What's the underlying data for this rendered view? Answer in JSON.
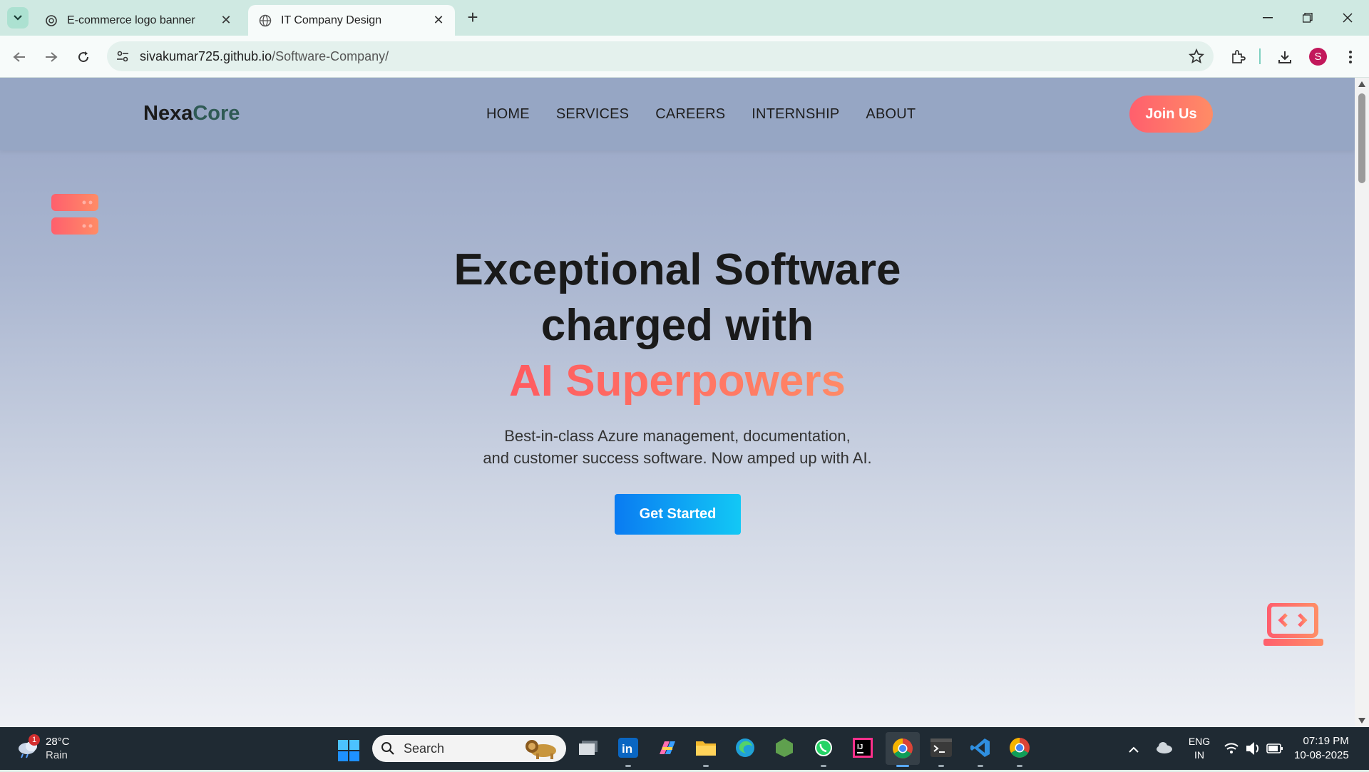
{
  "browser": {
    "tabs": [
      {
        "title": "E-commerce logo banner",
        "active": false
      },
      {
        "title": "IT Company Design",
        "active": true
      }
    ],
    "address": {
      "host": "sivakumar725.github.io",
      "path": "/Software-Company/"
    },
    "profile_initial": "S"
  },
  "site": {
    "logo_part1": "Nexa",
    "logo_part2": "Core",
    "nav": [
      "HOME",
      "SERVICES",
      "CAREERS",
      "INTERNSHIP",
      "ABOUT"
    ],
    "join_label": "Join Us",
    "hero": {
      "line1": "Exceptional Software",
      "line2": "charged with",
      "accent": "AI Superpowers",
      "sub1": "Best-in-class Azure management, documentation,",
      "sub2": "and customer success software. Now amped up with AI.",
      "cta": "Get Started"
    },
    "colors": {
      "accent_gradient_start": "#ff5f6d",
      "accent_gradient_end": "#ff8c66",
      "cta_start": "#0a7bf2",
      "cta_end": "#12c8f5"
    }
  },
  "taskbar": {
    "weather": {
      "temp": "28°C",
      "condition": "Rain",
      "badge": "1"
    },
    "search_placeholder": "Search",
    "lang1": "ENG",
    "lang2": "IN",
    "time": "07:19 PM",
    "date": "10-08-2025",
    "apps": [
      "task-view",
      "linkedin",
      "copilot",
      "file-explorer",
      "edge",
      "node",
      "whatsapp",
      "intellij",
      "chrome",
      "terminal",
      "vscode",
      "chrome-2"
    ]
  }
}
